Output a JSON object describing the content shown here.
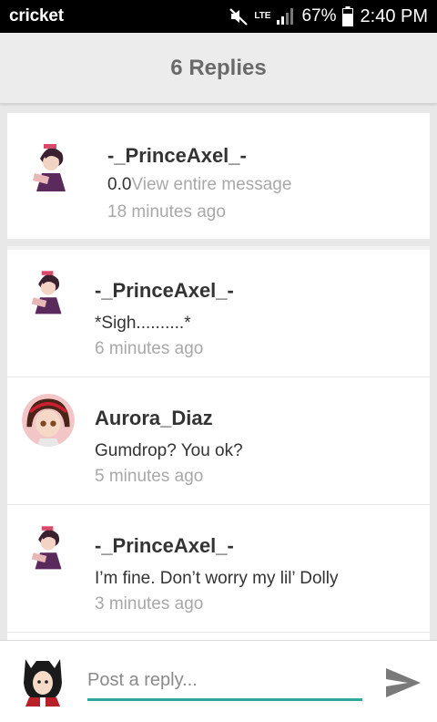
{
  "status_bar": {
    "carrier": "cricket",
    "network": "LTE",
    "battery": "67%",
    "time": "2:40 PM"
  },
  "header": {
    "title": "6 Replies"
  },
  "top_post": {
    "author": "-_PrinceAxel_-",
    "message": "0.0",
    "view_more": "View entire message",
    "time": "18 minutes ago"
  },
  "replies": [
    {
      "author": "-_PrinceAxel_-",
      "message": "*Sigh..........*",
      "time": "6 minutes ago"
    },
    {
      "author": "Aurora_Diaz",
      "message": "Gumdrop? You ok?",
      "time": "5 minutes ago"
    },
    {
      "author": "-_PrinceAxel_-",
      "message": "I’m fine. Don’t worry my lil’ Dolly",
      "time": "3 minutes ago"
    }
  ],
  "reply_bar": {
    "placeholder": "Post a reply..."
  },
  "icons": {
    "mute": "mute-icon",
    "signal": "signal-icon",
    "battery": "battery-icon",
    "send": "send-icon"
  },
  "colors": {
    "accent": "#2fa89e",
    "header_text": "#6a6a6a",
    "muted_text": "#a8a8a8"
  }
}
